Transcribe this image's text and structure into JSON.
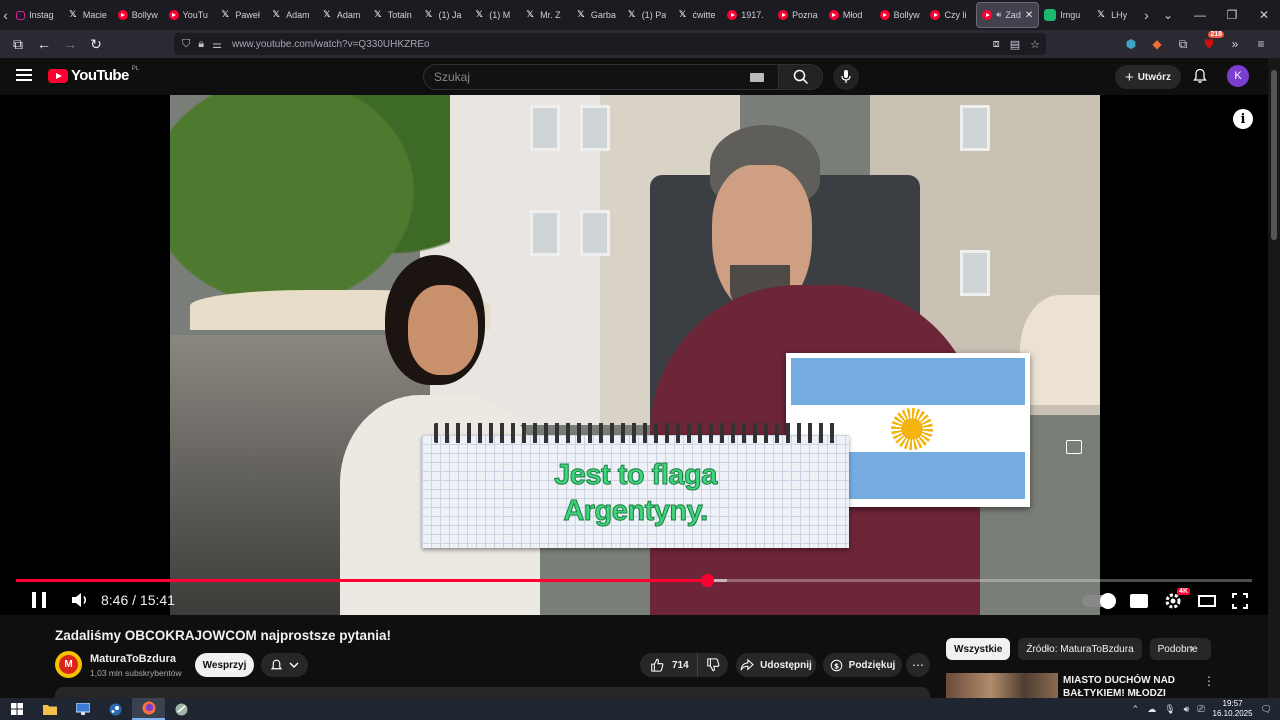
{
  "browser": {
    "tabs": [
      {
        "label": "Instag",
        "icon": "instagram-icon"
      },
      {
        "label": "Macie",
        "icon": "x-icon"
      },
      {
        "label": "Bollyw",
        "icon": "youtube-icon"
      },
      {
        "label": "YouTu",
        "icon": "youtube-icon"
      },
      {
        "label": "Paweł",
        "icon": "x-icon"
      },
      {
        "label": "Adam",
        "icon": "x-icon"
      },
      {
        "label": "Adam",
        "icon": "x-icon"
      },
      {
        "label": "Totaln",
        "icon": "x-icon"
      },
      {
        "label": "(1) Ja",
        "icon": "x-icon"
      },
      {
        "label": "(1) M",
        "icon": "x-icon"
      },
      {
        "label": "Mr. Z",
        "icon": "x-icon"
      },
      {
        "label": "Garba",
        "icon": "x-icon"
      },
      {
        "label": "(1) Pa",
        "icon": "x-icon"
      },
      {
        "label": "ćwitte",
        "icon": "x-icon"
      },
      {
        "label": "1917.",
        "icon": "youtube-icon"
      },
      {
        "label": "Pozna",
        "icon": "youtube-icon"
      },
      {
        "label": "Młod",
        "icon": "youtube-icon"
      },
      {
        "label": "Bollyw",
        "icon": "youtube-icon"
      },
      {
        "label": "Czy li",
        "icon": "youtube-icon"
      },
      {
        "label": "Zad",
        "icon": "youtube-icon",
        "active": true
      },
      {
        "label": "Imgu",
        "icon": "imgur-icon"
      },
      {
        "label": "LHy",
        "icon": "x-icon"
      }
    ],
    "url": "www.youtube.com/watch?v=Q330UHKZREo",
    "extension_badge": "218"
  },
  "youtube": {
    "logo_text": "YouTube",
    "logo_region": "PL",
    "search_placeholder": "Szukaj",
    "create_label": "Utwórz",
    "avatar_letter": "K"
  },
  "player": {
    "overlay_caption_line1": "Jest to flaga",
    "overlay_caption_line2": "Argentyny.",
    "current_time": "8:46",
    "duration": "15:41",
    "time_display": "8:46 / 15:41",
    "progress_fraction": 0.559,
    "buffered_fraction": 0.575,
    "quality_badge": "4K",
    "accent_color": "#ff0033"
  },
  "video": {
    "title": "Zadaliśmy OBCOKRAJOWCOM najprostsze pytania!",
    "channel": "MaturaToBzdura",
    "channel_avatar_letter": "M",
    "subscribers": "1,03 mln subskrybentów",
    "support_label": "Wesprzyj",
    "likes": "714",
    "share_label": "Udostępnij",
    "thanks_label": "Podziękuj"
  },
  "sidebar": {
    "chips": [
      "Wszystkie",
      "Źródło: MaturaToBzdura",
      "Podobne"
    ],
    "recommendation_title": "MIASTO DUCHÓW NAD BAŁTYKIEM! MŁODZI STAD"
  },
  "taskbar": {
    "time": "19:57",
    "date": "16.10.2025"
  }
}
